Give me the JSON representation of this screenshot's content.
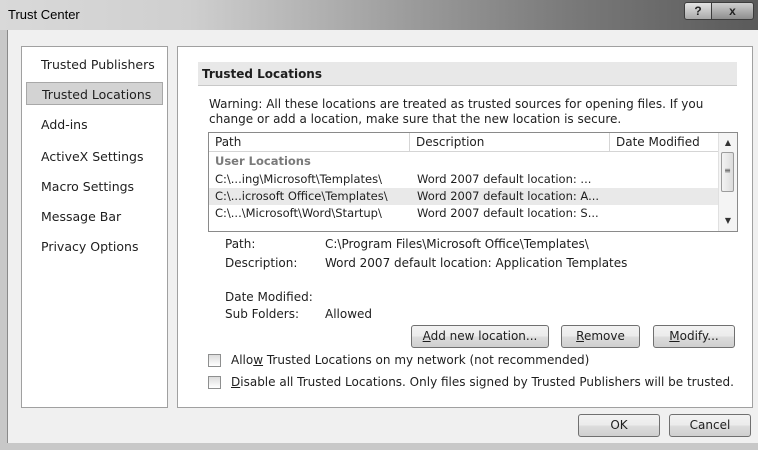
{
  "window": {
    "title": "Trust Center",
    "help_label": "?",
    "close_label": "x"
  },
  "nav": {
    "items": [
      {
        "label": "Trusted Publishers"
      },
      {
        "label": "Trusted Locations"
      },
      {
        "label": "Add-ins"
      },
      {
        "label": "ActiveX Settings"
      },
      {
        "label": "Macro Settings"
      },
      {
        "label": "Message Bar"
      },
      {
        "label": "Privacy Options"
      }
    ],
    "selected": "Trusted Locations"
  },
  "section": {
    "title": "Trusted Locations",
    "warning": "Warning: All these locations are treated as trusted sources for opening files.  If you change or add a location, make sure that the new location is secure."
  },
  "table": {
    "columns": [
      "Path",
      "Description",
      "Date Modified"
    ],
    "group": "User Locations",
    "rows": [
      {
        "path": "C:\\...ing\\Microsoft\\Templates\\",
        "description": "Word 2007 default location: ...",
        "date": ""
      },
      {
        "path": "C:\\...icrosoft Office\\Templates\\",
        "description": "Word 2007 default location: A...",
        "date": ""
      },
      {
        "path": "C:\\...\\Microsoft\\Word\\Startup\\",
        "description": "Word 2007 default location: S...",
        "date": ""
      }
    ]
  },
  "details": {
    "path_label": "Path:",
    "path_value": "C:\\Program Files\\Microsoft Office\\Templates\\",
    "description_label": "Description:",
    "description_value": "Word 2007 default location: Application Templates",
    "date_label": "Date Modified:",
    "date_value": "",
    "subfolders_label": "Sub Folders:",
    "subfolders_value": "Allowed"
  },
  "buttons": {
    "add_pre": "",
    "add_u": "A",
    "add_post": "dd new location...",
    "remove_pre": "",
    "remove_u": "R",
    "remove_post": "emove",
    "modify_pre": "",
    "modify_u": "M",
    "modify_post": "odify...",
    "ok": "OK",
    "cancel": "Cancel"
  },
  "checkboxes": {
    "allow_network": {
      "pre": "Allo",
      "u": "w",
      "post": " Trusted Locations on my network (not recommended)",
      "checked": false
    },
    "disable_all": {
      "pre": "",
      "u": "D",
      "post": "isable all Trusted Locations. Only files signed by Trusted Publishers will be trusted.",
      "checked": false
    }
  }
}
